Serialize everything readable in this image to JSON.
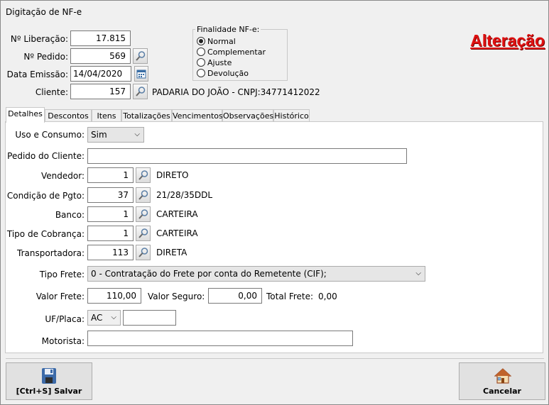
{
  "window": {
    "title": "Digitação de NF-e"
  },
  "mode_label": "Alteração",
  "header": {
    "liberacao_label": "Nº Liberação:",
    "liberacao_value": "17.815",
    "pedido_label": "Nº Pedido:",
    "pedido_value": "569",
    "emissao_label": "Data Emissão:",
    "emissao_value": "14/04/2020",
    "cliente_label": "Cliente:",
    "cliente_value": "157",
    "cliente_name": "PADARIA DO JOÃO - CNPJ:34771412022"
  },
  "finalidade": {
    "title": "Finalidade NF-e:",
    "options": [
      "Normal",
      "Complementar",
      "Ajuste",
      "Devolução"
    ],
    "selected": "Normal"
  },
  "tabs": [
    "Detalhes",
    "Descontos",
    "Itens",
    "Totalizações",
    "Vencimentos",
    "Observações",
    "Histórico"
  ],
  "active_tab": "Detalhes",
  "detalhes": {
    "uso_label": "Uso e Consumo:",
    "uso_value": "Sim",
    "pedido_cliente_label": "Pedido do Cliente:",
    "pedido_cliente_value": "",
    "vendedor_label": "Vendedor:",
    "vendedor_value": "1",
    "vendedor_desc": "DIRETO",
    "condicao_label": "Condição de Pgto:",
    "condicao_value": "37",
    "condicao_desc": "21/28/35DDL",
    "banco_label": "Banco:",
    "banco_value": "1",
    "banco_desc": "CARTEIRA",
    "tipo_cobranca_label": "Tipo de Cobrança:",
    "tipo_cobranca_value": "1",
    "tipo_cobranca_desc": "CARTEIRA",
    "transportadora_label": "Transportadora:",
    "transportadora_value": "113",
    "transportadora_desc": "DIRETA",
    "tipo_frete_label": "Tipo Frete:",
    "tipo_frete_value": "0 - Contratação do Frete por conta do Remetente (CIF);",
    "valor_frete_label": "Valor Frete:",
    "valor_frete_value": "110,00",
    "valor_seguro_label": "Valor Seguro:",
    "valor_seguro_value": "0,00",
    "total_frete_label": "Total Frete:",
    "total_frete_value": "0,00",
    "uf_placa_label": "UF/Placa:",
    "uf_value": "AC",
    "placa_value": "",
    "motorista_label": "Motorista:",
    "motorista_value": ""
  },
  "buttons": {
    "save": "[Ctrl+S] Salvar",
    "cancel": "Cancelar"
  },
  "colors": {
    "mode": "#e01010",
    "panel": "#ffffff",
    "background": "#f0f0f0"
  }
}
